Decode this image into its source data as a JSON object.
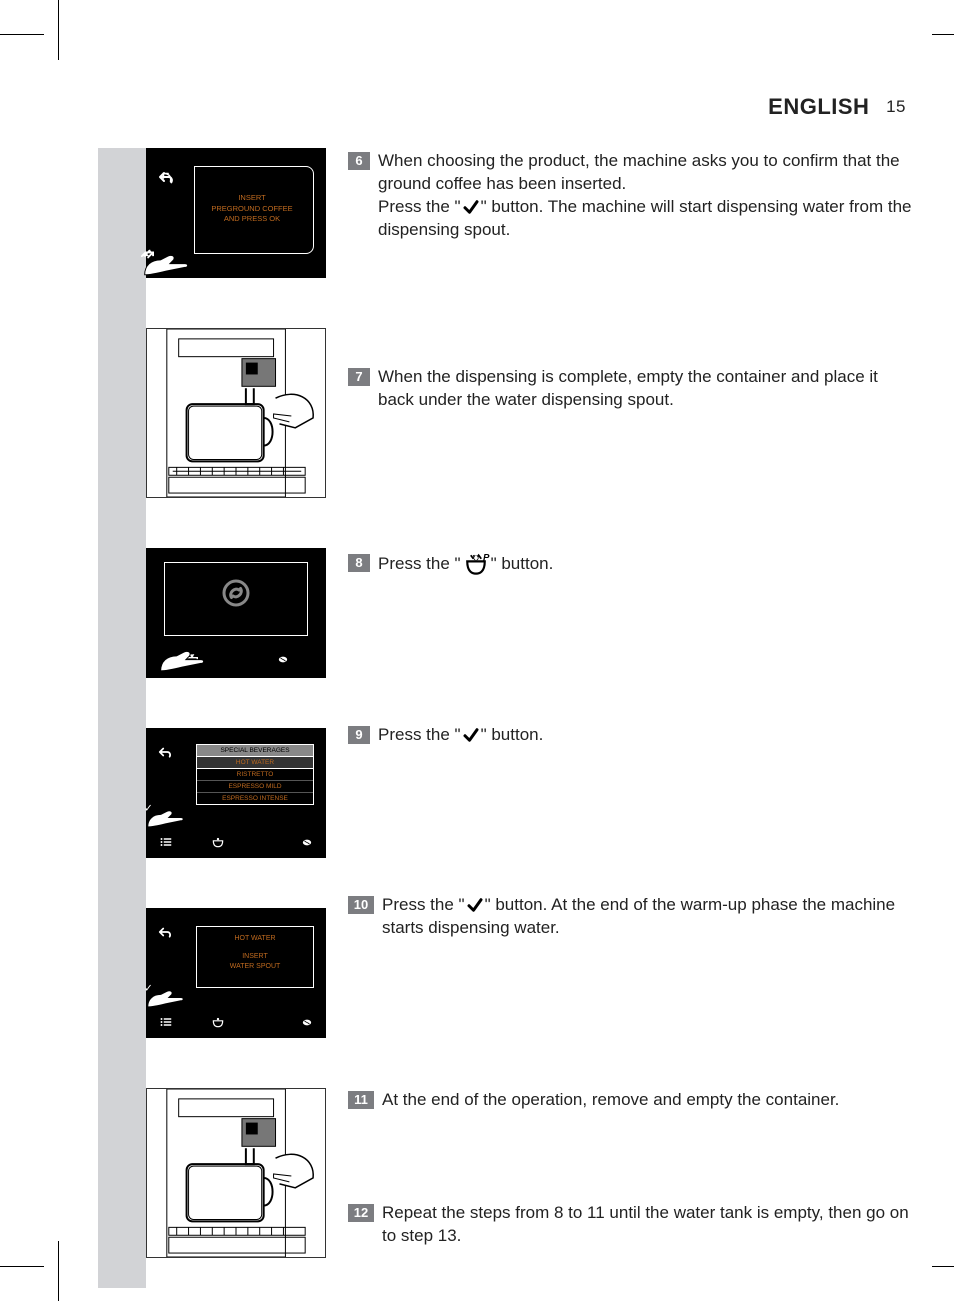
{
  "header": {
    "lang": "ENGLISH",
    "page": "15"
  },
  "screen6": {
    "line1": "INSERT",
    "line2": "PREGROUND COFFEE",
    "line3": "AND PRESS OK"
  },
  "screen9": {
    "title": "SPECIAL BEVERAGES",
    "items": [
      "HOT WATER",
      "RISTRETTO",
      "ESPRESSO MILD",
      "ESPRESSO INTENSE"
    ]
  },
  "screen10": {
    "title": "HOT WATER",
    "sub1": "INSERT",
    "sub2": "WATER SPOUT"
  },
  "steps": {
    "s6": {
      "num": "6",
      "a": "When choosing the product, the machine asks you to confirm that the ground coffee has been inserted.",
      "b1": "Press the \"",
      "b2": "\" button. The machine will start dispensing water from the dispensing spout."
    },
    "s7": {
      "num": "7",
      "a": "When the dispensing is complete, empty the container and place it back under the water dispensing spout."
    },
    "s8": {
      "num": "8",
      "a": "Press the \"",
      "b": "\" button."
    },
    "s9": {
      "num": "9",
      "a": "Press the \"",
      "b": "\" button."
    },
    "s10": {
      "num": "10",
      "a": "Press the \"",
      "b": "\" button. At the end of the warm-up phase the machine starts dispensing water."
    },
    "s11": {
      "num": "11",
      "a": "At the end of the operation, remove and empty the container."
    },
    "s12": {
      "num": "12",
      "a": "Repeat the steps from 8 to 11 until the water tank is empty, then go on to step 13."
    }
  }
}
